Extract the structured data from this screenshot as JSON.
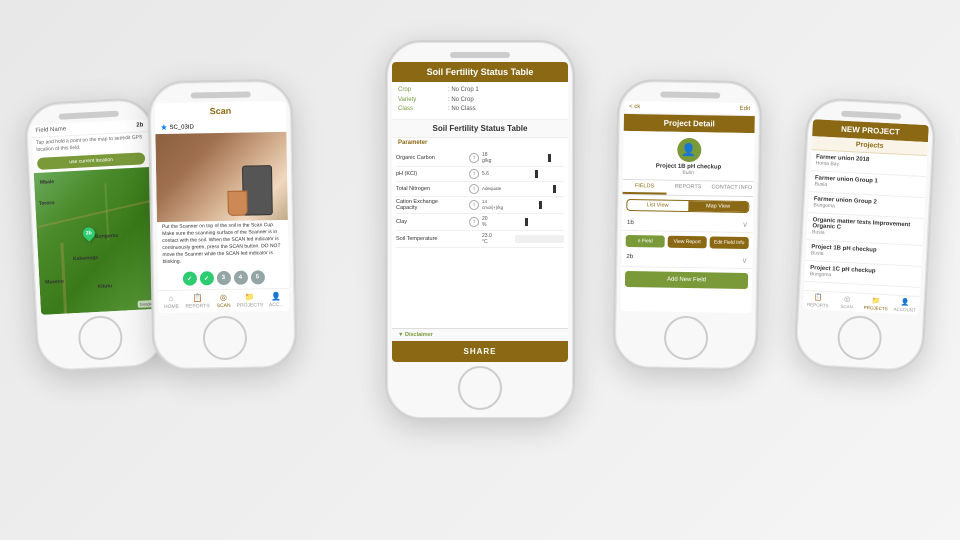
{
  "scene": {
    "bg_color": "#ebebeb"
  },
  "phone1": {
    "field_label": "Field Name",
    "field_value": "2b",
    "tap_text": "Tap and hold a point on the map to set/edit GPS location of this field.",
    "use_location_btn": "use current location",
    "pin_label": "2b",
    "map_labels": [
      "Mbale",
      "Tororo",
      "Bungoma",
      "Kakamega",
      "Maseno",
      "Kitutu"
    ],
    "google_label": "Google"
  },
  "phone2": {
    "title": "Scan",
    "bt_label": "SC_03ID",
    "instruction": "Put the Scanner on top of the soil in the Scan Cup. Make sure the scanning surface of the Scanner is in contact with the soil. When the SCAN led indicator is continuously green, press the SCAN button. DO NOT move the Scanner while the SCAN led indicator is blinking.",
    "steps": [
      {
        "label": "✓",
        "done": true
      },
      {
        "label": "✓",
        "done": true
      },
      {
        "label": "3",
        "done": false
      },
      {
        "label": "4",
        "done": false
      },
      {
        "label": "5",
        "done": false
      }
    ],
    "nav_items": [
      "HOME",
      "REPORTS",
      "SCAN",
      "PROJECTS",
      "ACC..."
    ]
  },
  "phone3": {
    "header": "Soil Fertility Status Table",
    "crop_label": "Crop",
    "crop_value": "No Crop 1",
    "variety_label": "Variety",
    "variety_value": "No Crop",
    "class_label": "Class",
    "class_value": "No Class",
    "subheader": "Soil Fertility Status Table",
    "param_label": "Parameter",
    "rows": [
      {
        "name": "Organic Carbon",
        "unit": "18\ng/kg",
        "status": "mid"
      },
      {
        "name": "pH (KCl)",
        "unit": "5.6",
        "status": "low"
      },
      {
        "name": "Total Nitrogen",
        "unit": "Adequate",
        "status": "high"
      },
      {
        "name": "Cation Exchange Capacity",
        "unit": "14\ncmol(+)/kg",
        "status": "mid"
      },
      {
        "name": "Clay",
        "unit": "20\n%",
        "status": "low"
      },
      {
        "name": "Soil Temperature",
        "unit": "23.0\n°C",
        "status": "mid"
      }
    ],
    "disclaimer_label": "▼ Disclaimer",
    "share_btn": "SHARE"
  },
  "phone4": {
    "back_label": "< ck",
    "edit_label": "Edit",
    "header": "Project Detail",
    "project_name": "Project 1B pH checkup",
    "project_location": "Butirr",
    "tabs": [
      "FIELDS",
      "REPORTS",
      "CONTACT INFO"
    ],
    "list_view": "List View",
    "map_view": "Map View",
    "field_item1": "1b",
    "field_item2": "2b",
    "action_btns": [
      "n Field",
      "View Report",
      "Edit Field Info"
    ],
    "add_btn": "Add New Field"
  },
  "phone5": {
    "header": "NEW PROJECT",
    "subheader": "Projects",
    "items": [
      {
        "name": "Farmer union 2018",
        "location": "Homa Bay"
      },
      {
        "name": "Farmer union Group 1",
        "location": "Busia"
      },
      {
        "name": "Farmer union Group 2",
        "location": "Bungoma"
      },
      {
        "name": "Organic matter tests Improvement Organic C",
        "location": "Busia"
      },
      {
        "name": "Project 1B pH checkup",
        "location": "Busia"
      },
      {
        "name": "Project 1C pH checkup",
        "location": "Bungoma"
      }
    ],
    "nav_items": [
      "REPORTS",
      "SCAN",
      "PROJECTS",
      "ACCOUNT"
    ]
  }
}
